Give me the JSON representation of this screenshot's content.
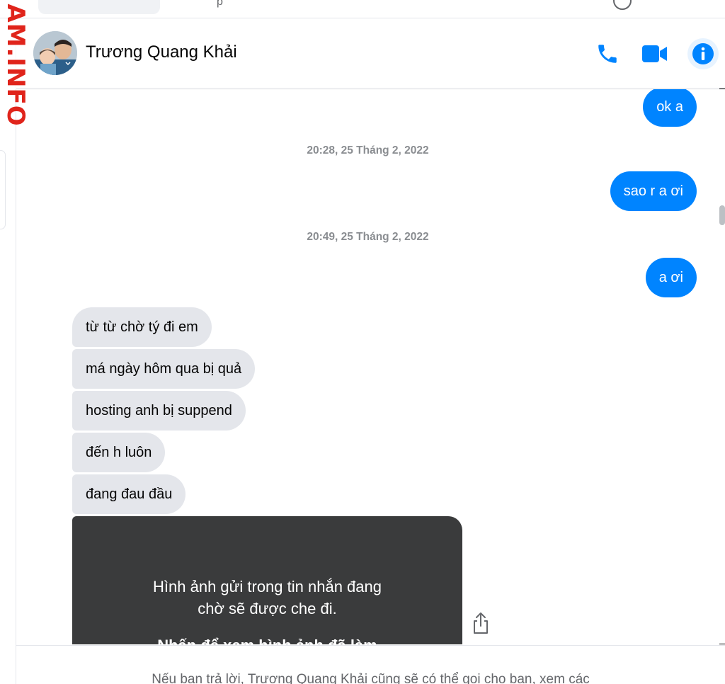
{
  "watermark": "AM.INFO",
  "top_fragment": "p",
  "contact": {
    "name": "Trương Quang Khải"
  },
  "header_actions": {
    "call_icon": "phone-icon",
    "video_icon": "video-icon",
    "info_icon": "info-icon"
  },
  "messages": {
    "out_1": "ok a",
    "ts_1": "20:28, 25 Tháng 2, 2022",
    "out_2": "sao r a ơi",
    "ts_2": "20:49, 25 Tháng 2, 2022",
    "out_3": "a ơi",
    "in_1": "từ từ chờ tý đi em",
    "in_2": "má ngày hôm qua bị quả",
    "in_3": "hosting anh bị suppend",
    "in_4": "đến h luôn",
    "in_5": "đang đau đầu",
    "media_line1": "Hình ảnh gửi trong tin nhắn đang",
    "media_line2": "chờ sẽ được che đi.",
    "media_action": "Nhấn để xem hình ảnh đã làm"
  },
  "footer": {
    "notice": "Nếu bạn trả lời, Trương Quang Khải cũng sẽ có thể gọi cho bạn, xem các"
  },
  "colors": {
    "accent": "#0084ff",
    "incoming_bg": "#e4e6eb",
    "watermark": "#e0241b",
    "media_bg": "#3a3b3c"
  }
}
